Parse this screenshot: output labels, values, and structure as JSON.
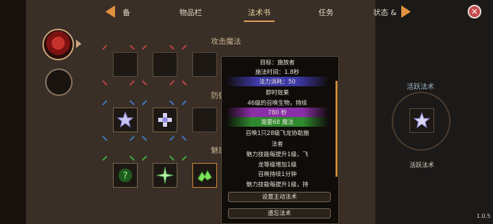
{
  "tabs": [
    {
      "label": "备"
    },
    {
      "label": "物品栏"
    },
    {
      "label": "法术书"
    },
    {
      "label": "任务"
    },
    {
      "label": "状态 &"
    }
  ],
  "sections": {
    "attack": "攻击魔法",
    "defense": "防御魔法",
    "charm": "魅惑魔法"
  },
  "tooltip": {
    "line0": "目标：施放者",
    "cast_time": "施法时间：1.8秒",
    "mana_cost": "法力消耗：50",
    "immediate": "即时效果",
    "summon_desc": "46级的召唤生物，持续",
    "duration": "780 秒",
    "requirement": "需要68 魔法",
    "summon1": "召唤1只28级飞龙协助施",
    "summon2": "法者",
    "charm1": "魅力技能每提升1级，飞",
    "charm2": "龙等级增加1级",
    "duration_rule": "召唤持续1分钟",
    "charm3": "魅力技能每提升1级，持"
  },
  "buttons": {
    "set_active": "设置主动法术",
    "forget": "遗忘法术"
  },
  "active": {
    "title": "活跃法术",
    "label": "活跃法术"
  },
  "version": "1.0.5",
  "colors": {
    "accent": "#e2923f",
    "mana_band": "#3f3aa6",
    "duration_band": "#8a2fa6",
    "requirement_band": "#2f8a2f"
  }
}
